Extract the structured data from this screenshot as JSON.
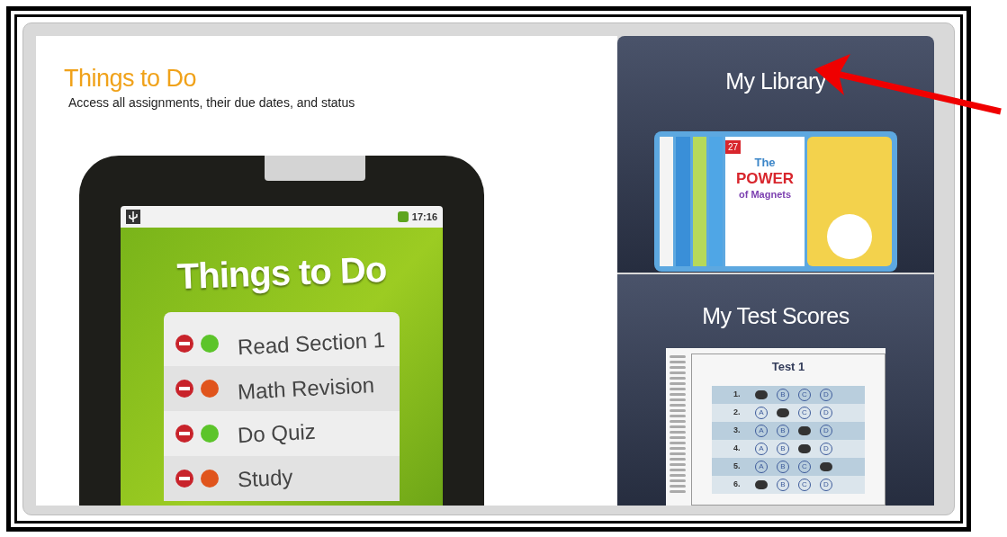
{
  "left_panel": {
    "title": "Things to Do",
    "subtitle": "Access all assignments, their due dates, and status",
    "tablet": {
      "clock": "17:16",
      "screen_title": "Things to Do",
      "items": [
        {
          "label": "Read Section 1",
          "color": "#5cc42a"
        },
        {
          "label": "Math Revision",
          "color": "#e0541c"
        },
        {
          "label": "Do Quiz",
          "color": "#5cc42a"
        },
        {
          "label": "Study",
          "color": "#e0541c"
        }
      ]
    }
  },
  "library": {
    "title": "My Library",
    "book": {
      "badge": "27",
      "line_1": "The",
      "line_2": "POWER",
      "line_3": "of Magnets"
    }
  },
  "test_scores": {
    "title": "My Test Scores",
    "sheet": {
      "title": "Test 1",
      "rows": [
        {
          "number": "1.",
          "bubbles": [
            {
              "filled": true
            },
            {
              "letter": "B",
              "filled": false
            },
            {
              "letter": "C",
              "filled": false
            },
            {
              "letter": "D",
              "filled": false
            }
          ]
        },
        {
          "number": "2.",
          "bubbles": [
            {
              "letter": "A",
              "filled": false
            },
            {
              "filled": true
            },
            {
              "letter": "C",
              "filled": false
            },
            {
              "letter": "D",
              "filled": false
            }
          ]
        },
        {
          "number": "3.",
          "bubbles": [
            {
              "letter": "A",
              "filled": false
            },
            {
              "letter": "B",
              "filled": false
            },
            {
              "filled": true
            },
            {
              "letter": "D",
              "filled": false
            }
          ]
        },
        {
          "number": "4.",
          "bubbles": [
            {
              "letter": "A",
              "filled": false
            },
            {
              "letter": "B",
              "filled": false
            },
            {
              "filled": true
            },
            {
              "letter": "D",
              "filled": false
            }
          ]
        },
        {
          "number": "5.",
          "bubbles": [
            {
              "letter": "A",
              "filled": false
            },
            {
              "letter": "B",
              "filled": false
            },
            {
              "letter": "C",
              "filled": false
            },
            {
              "filled": true
            }
          ]
        },
        {
          "number": "6.",
          "bubbles": [
            {
              "filled": true
            },
            {
              "letter": "B",
              "filled": false
            },
            {
              "letter": "C",
              "filled": false
            },
            {
              "letter": "D",
              "filled": false
            }
          ]
        }
      ]
    }
  }
}
